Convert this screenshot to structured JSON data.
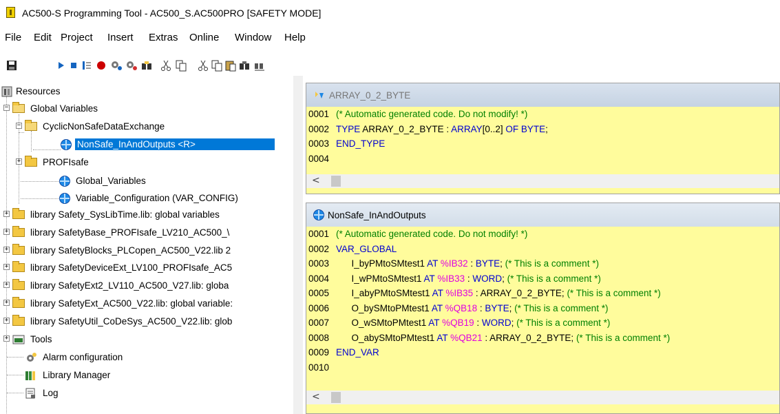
{
  "window": {
    "title": "AC500-S Programming Tool - AC500_S.AC500PRO [SAFETY MODE]"
  },
  "menu": [
    "File",
    "Edit",
    "Project",
    "Insert",
    "Extras",
    "Online",
    "Window",
    "Help"
  ],
  "toolbar": {
    "buttons": [
      "save-icon",
      "run-icon",
      "stop-icon",
      "step-icon",
      "breakpoint-icon",
      "login-icon",
      "logout-icon",
      "find-binoculars-icon",
      "cut-icon",
      "copy-icon",
      "cut2-icon",
      "copy2-icon",
      "paste-icon",
      "find-icon",
      "find-next-icon"
    ]
  },
  "tree": {
    "resources": "Resources",
    "global_variables": "Global Variables",
    "cyclic": "CyclicNonSafeDataExchange",
    "nonsafe": "NonSafe_InAndOutputs <R>",
    "profisafe": "PROFIsafe",
    "global_vars": "Global_Variables",
    "var_config": "Variable_Configuration (VAR_CONFIG)",
    "libs": [
      "library Safety_SysLibTime.lib: global variables",
      "library SafetyBase_PROFIsafe_LV210_AC500_\\",
      "library SafetyBlocks_PLCopen_AC500_V22.lib 2",
      "library SafetyDeviceExt_LV100_PROFIsafe_AC5",
      "library SafetyExt2_LV110_AC500_V27.lib: globa",
      "library SafetyExt_AC500_V22.lib: global variable:",
      "library SafetyUtil_CoDeSys_AC500_V22.lib: glob"
    ],
    "tools": "Tools",
    "alarm": "Alarm configuration",
    "libmgr": "Library Manager",
    "log": "Log"
  },
  "panel1": {
    "title": "ARRAY_0_2_BYTE",
    "lines": [
      {
        "n": "0001",
        "parts": [
          {
            "t": "(* Automatic generated code. Do not modify! *)",
            "c": "cm"
          }
        ]
      },
      {
        "n": "0002",
        "parts": [
          {
            "t": "TYPE ",
            "c": "kw"
          },
          {
            "t": "ARRAY_0_2_BYTE : ",
            "c": ""
          },
          {
            "t": "ARRAY",
            "c": "kw"
          },
          {
            "t": "[0..2] ",
            "c": ""
          },
          {
            "t": "OF BYTE",
            "c": "kw"
          },
          {
            "t": ";",
            "c": ""
          }
        ]
      },
      {
        "n": "0003",
        "parts": [
          {
            "t": "END_TYPE",
            "c": "kw"
          }
        ]
      },
      {
        "n": "0004",
        "parts": []
      }
    ]
  },
  "panel2": {
    "title": "NonSafe_InAndOutputs",
    "lines": [
      {
        "n": "0001",
        "parts": [
          {
            "t": "(* Automatic generated code. Do not modify! *)",
            "c": "cm"
          }
        ]
      },
      {
        "n": "0002",
        "parts": [
          {
            "t": "VAR_GLOBAL",
            "c": "kw"
          }
        ]
      },
      {
        "n": "0003",
        "parts": [
          {
            "t": "      I_byPMtoSMtest1 ",
            "c": ""
          },
          {
            "t": "AT ",
            "c": "kw"
          },
          {
            "t": "%IB32",
            "c": "ad"
          },
          {
            "t": " : ",
            "c": ""
          },
          {
            "t": "BYTE",
            "c": "kw"
          },
          {
            "t": "; ",
            "c": ""
          },
          {
            "t": "(* This is a comment *)",
            "c": "cm"
          }
        ]
      },
      {
        "n": "0004",
        "parts": [
          {
            "t": "      I_wPMtoSMtest1 ",
            "c": ""
          },
          {
            "t": "AT ",
            "c": "kw"
          },
          {
            "t": "%IB33",
            "c": "ad"
          },
          {
            "t": " : ",
            "c": ""
          },
          {
            "t": "WORD",
            "c": "kw"
          },
          {
            "t": "; ",
            "c": ""
          },
          {
            "t": "(* This is a comment *)",
            "c": "cm"
          }
        ]
      },
      {
        "n": "0005",
        "parts": [
          {
            "t": "      I_abyPMtoSMtest1 ",
            "c": ""
          },
          {
            "t": "AT ",
            "c": "kw"
          },
          {
            "t": "%IB35",
            "c": "ad"
          },
          {
            "t": " : ARRAY_0_2_BYTE; ",
            "c": ""
          },
          {
            "t": "(* This is a comment *)",
            "c": "cm"
          }
        ]
      },
      {
        "n": "0006",
        "parts": [
          {
            "t": "      O_bySMtoPMtest1 ",
            "c": ""
          },
          {
            "t": "AT ",
            "c": "kw"
          },
          {
            "t": "%QB18",
            "c": "ad"
          },
          {
            "t": " : ",
            "c": ""
          },
          {
            "t": "BYTE",
            "c": "kw"
          },
          {
            "t": "; ",
            "c": ""
          },
          {
            "t": "(* This is a comment *)",
            "c": "cm"
          }
        ]
      },
      {
        "n": "0007",
        "parts": [
          {
            "t": "      O_wSMtoPMtest1 ",
            "c": ""
          },
          {
            "t": "AT ",
            "c": "kw"
          },
          {
            "t": "%QB19",
            "c": "ad"
          },
          {
            "t": " : ",
            "c": ""
          },
          {
            "t": "WORD",
            "c": "kw"
          },
          {
            "t": "; ",
            "c": ""
          },
          {
            "t": "(* This is a comment *)",
            "c": "cm"
          }
        ]
      },
      {
        "n": "0008",
        "parts": [
          {
            "t": "      O_abySMtoPMtest1 ",
            "c": ""
          },
          {
            "t": "AT ",
            "c": "kw"
          },
          {
            "t": "%QB21",
            "c": "ad"
          },
          {
            "t": " : ARRAY_0_2_BYTE; ",
            "c": ""
          },
          {
            "t": "(* This is a comment *)",
            "c": "cm"
          }
        ]
      },
      {
        "n": "0009",
        "parts": [
          {
            "t": "END_VAR",
            "c": "kw"
          }
        ]
      },
      {
        "n": "0010",
        "parts": []
      }
    ]
  },
  "colors": {
    "selection": "#0078d7",
    "editor_bg": "#fffc9c",
    "keyword": "#0000d0",
    "comment": "#008000",
    "address": "#e000e0"
  }
}
